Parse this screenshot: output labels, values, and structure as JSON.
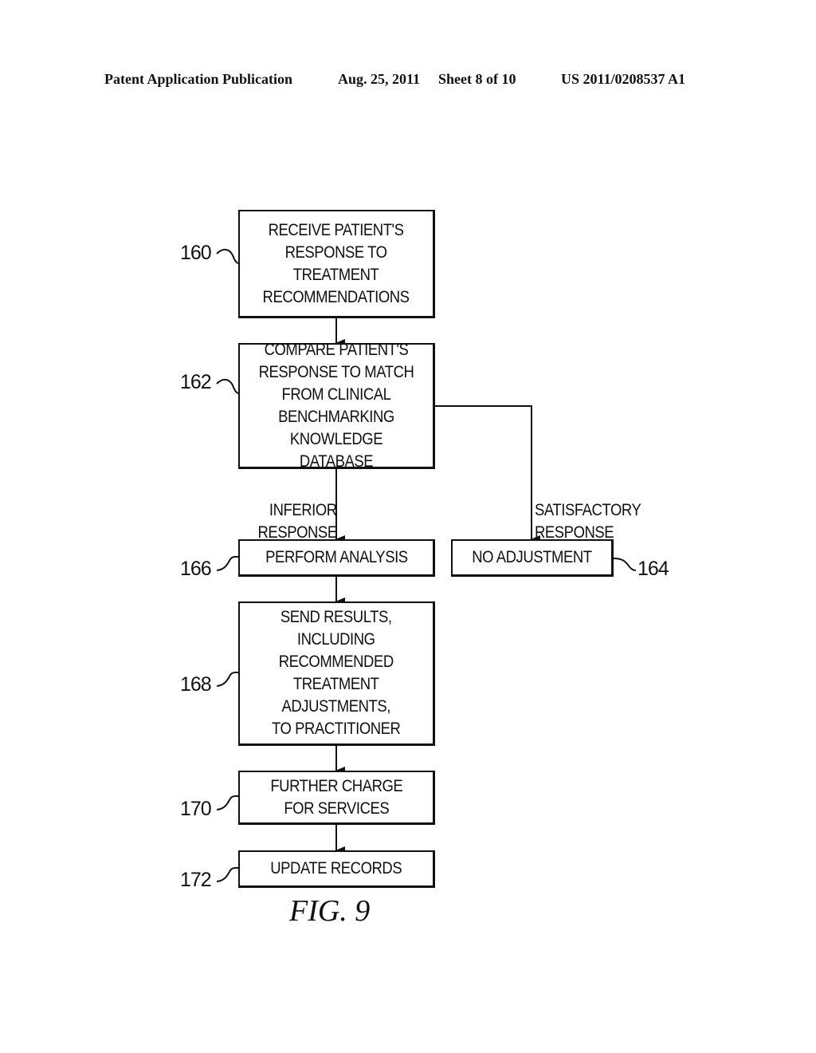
{
  "header": {
    "publication": "Patent Application Publication",
    "date": "Aug. 25, 2011",
    "sheet": "Sheet 8 of 10",
    "number": "US 2011/0208537 A1"
  },
  "steps": [
    {
      "ref": "160",
      "text": "RECEIVE PATIENT'S\nRESPONSE TO\nTREATMENT\nRECOMMENDATIONS"
    },
    {
      "ref": "162",
      "text": "COMPARE PATIENT'S\nRESPONSE TO MATCH\nFROM CLINICAL\nBENCHMARKING\nKNOWLEDGE DATABASE"
    },
    {
      "ref": "164",
      "text": "NO ADJUSTMENT"
    },
    {
      "ref": "166",
      "text": "PERFORM ANALYSIS"
    },
    {
      "ref": "168",
      "text": "SEND RESULTS,\nINCLUDING\nRECOMMENDED\nTREATMENT\nADJUSTMENTS,\nTO PRACTITIONER"
    },
    {
      "ref": "170",
      "text": "FURTHER CHARGE\nFOR SERVICES"
    },
    {
      "ref": "172",
      "text": "UPDATE RECORDS"
    }
  ],
  "branches": {
    "inferior": "INFERIOR\nRESPONSE",
    "satisfactory": "SATISFACTORY\nRESPONSE"
  },
  "figure_label": "FIG. 9"
}
